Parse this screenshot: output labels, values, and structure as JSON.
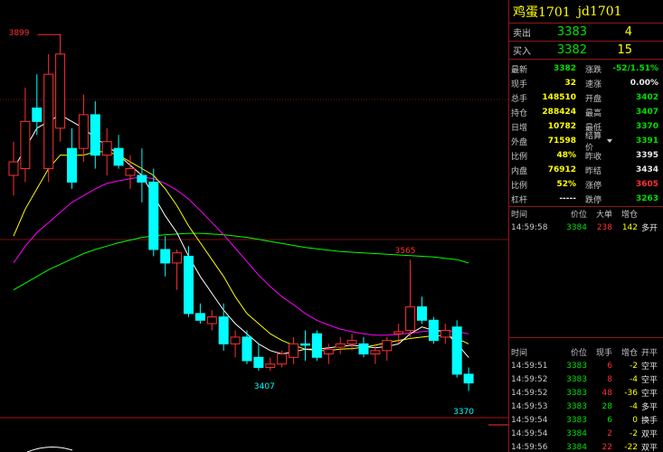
{
  "contract": {
    "name": "鸡蛋1701",
    "code": "jd1701"
  },
  "quote": {
    "ask_label": "卖出",
    "ask_price": "3383",
    "ask_vol": "4",
    "bid_label": "买入",
    "bid_price": "3382",
    "bid_vol": "15"
  },
  "stats": [
    {
      "l": "最新",
      "v": "3382",
      "vc": "green",
      "l2": "涨跌",
      "v2": "-52/1.51%",
      "v2c": "green"
    },
    {
      "l": "现手",
      "v": "32",
      "vc": "yellow",
      "l2": "速涨",
      "v2": "0.00%",
      "v2c": "white"
    },
    {
      "l": "总手",
      "v": "148510",
      "vc": "yellow",
      "l2": "开盘",
      "v2": "3402",
      "v2c": "green"
    },
    {
      "l": "持仓",
      "v": "288424",
      "vc": "yellow",
      "l2": "最高",
      "v2": "3407",
      "v2c": "green"
    },
    {
      "l": "日增",
      "v": "10782",
      "vc": "yellow",
      "l2": "最低",
      "v2": "3370",
      "v2c": "green"
    },
    {
      "l": "外盘",
      "v": "71598",
      "vc": "yellow",
      "l2": "结算价",
      "v2": "3391",
      "v2c": "green",
      "drop": true
    },
    {
      "l": "比例",
      "v": "48%",
      "vc": "yellow",
      "l2": "昨收",
      "v2": "3395",
      "v2c": "white"
    },
    {
      "l": "内盘",
      "v": "76912",
      "vc": "yellow",
      "l2": "昨结",
      "v2": "3434",
      "v2c": "white"
    },
    {
      "l": "比例",
      "v": "52%",
      "vc": "yellow",
      "l2": "涨停",
      "v2": "3605",
      "v2c": "red"
    },
    {
      "l": "杠杆",
      "v": "-----",
      "vc": "white",
      "l2": "跌停",
      "v2": "3263",
      "v2c": "green"
    }
  ],
  "big_trades": {
    "headers": [
      "时间",
      "价位",
      "大单",
      "增仓"
    ],
    "rows": [
      {
        "time": "14:59:58",
        "price": "3384",
        "big": "238",
        "pos": "142",
        "open": "多开"
      }
    ]
  },
  "trades": {
    "headers": [
      "时间",
      "价位",
      "现手",
      "增仓",
      "开平"
    ],
    "rows": [
      {
        "time": "14:59:51",
        "price": "3383",
        "vol": "6",
        "vc": "red",
        "pos": "-2",
        "open": "空平"
      },
      {
        "time": "14:59:52",
        "price": "3383",
        "vol": "8",
        "vc": "red",
        "pos": "-4",
        "open": "空平"
      },
      {
        "time": "14:59:52",
        "price": "3383",
        "vol": "48",
        "vc": "red",
        "pos": "-36",
        "open": "空平"
      },
      {
        "time": "14:59:53",
        "price": "3383",
        "vol": "28",
        "vc": "green",
        "pos": "-4",
        "open": "多平"
      },
      {
        "time": "14:59:54",
        "price": "3383",
        "vol": "6",
        "vc": "green",
        "pos": "0",
        "open": "换手"
      },
      {
        "time": "14:59:54",
        "price": "3384",
        "vol": "2",
        "vc": "red",
        "pos": "-2",
        "open": "双平"
      },
      {
        "time": "14:59:56",
        "price": "3384",
        "vol": "22",
        "vc": "red",
        "pos": "-22",
        "open": "双平"
      }
    ]
  },
  "colors": {
    "up": "#ff3030",
    "down": "#00ffff",
    "ma1": "#ffffff",
    "ma2": "#ffff00",
    "ma3": "#ff00ff",
    "ma4": "#00ff00"
  },
  "chart_data": {
    "type": "candlestick",
    "ylim": [
      3360,
      3910
    ],
    "candles": [
      {
        "o": 3690,
        "h": 3740,
        "l": 3660,
        "c": 3710
      },
      {
        "o": 3700,
        "h": 3820,
        "l": 3680,
        "c": 3770
      },
      {
        "o": 3790,
        "h": 3840,
        "l": 3750,
        "c": 3770
      },
      {
        "o": 3700,
        "h": 3870,
        "l": 3680,
        "c": 3840
      },
      {
        "o": 3760,
        "h": 3900,
        "l": 3740,
        "c": 3870
      },
      {
        "o": 3730,
        "h": 3760,
        "l": 3670,
        "c": 3680
      },
      {
        "o": 3730,
        "h": 3810,
        "l": 3710,
        "c": 3780
      },
      {
        "o": 3780,
        "h": 3800,
        "l": 3700,
        "c": 3720
      },
      {
        "o": 3720,
        "h": 3760,
        "l": 3690,
        "c": 3740
      },
      {
        "o": 3730,
        "h": 3750,
        "l": 3700,
        "c": 3705
      },
      {
        "o": 3690,
        "h": 3720,
        "l": 3670,
        "c": 3700
      },
      {
        "o": 3690,
        "h": 3730,
        "l": 3650,
        "c": 3680
      },
      {
        "o": 3680,
        "h": 3700,
        "l": 3570,
        "c": 3580
      },
      {
        "o": 3580,
        "h": 3600,
        "l": 3540,
        "c": 3560
      },
      {
        "o": 3560,
        "h": 3580,
        "l": 3520,
        "c": 3575
      },
      {
        "o": 3570,
        "h": 3585,
        "l": 3480,
        "c": 3485
      },
      {
        "o": 3485,
        "h": 3500,
        "l": 3470,
        "c": 3475
      },
      {
        "o": 3470,
        "h": 3490,
        "l": 3460,
        "c": 3480
      },
      {
        "o": 3480,
        "h": 3500,
        "l": 3430,
        "c": 3440
      },
      {
        "o": 3440,
        "h": 3460,
        "l": 3420,
        "c": 3450
      },
      {
        "o": 3450,
        "h": 3460,
        "l": 3410,
        "c": 3415
      },
      {
        "o": 3420,
        "h": 3440,
        "l": 3400,
        "c": 3405
      },
      {
        "o": 3405,
        "h": 3420,
        "l": 3400,
        "c": 3410
      },
      {
        "o": 3410,
        "h": 3430,
        "l": 3405,
        "c": 3425
      },
      {
        "o": 3420,
        "h": 3450,
        "l": 3410,
        "c": 3440
      },
      {
        "o": 3440,
        "h": 3460,
        "l": 3415,
        "c": 3438
      },
      {
        "o": 3455,
        "h": 3460,
        "l": 3415,
        "c": 3420
      },
      {
        "o": 3425,
        "h": 3440,
        "l": 3410,
        "c": 3432
      },
      {
        "o": 3435,
        "h": 3450,
        "l": 3425,
        "c": 3440
      },
      {
        "o": 3440,
        "h": 3455,
        "l": 3430,
        "c": 3445
      },
      {
        "o": 3440,
        "h": 3450,
        "l": 3420,
        "c": 3425
      },
      {
        "o": 3425,
        "h": 3440,
        "l": 3410,
        "c": 3430
      },
      {
        "o": 3430,
        "h": 3450,
        "l": 3415,
        "c": 3445
      },
      {
        "o": 3455,
        "h": 3470,
        "l": 3440,
        "c": 3458
      },
      {
        "o": 3460,
        "h": 3565,
        "l": 3450,
        "c": 3495
      },
      {
        "o": 3495,
        "h": 3510,
        "l": 3470,
        "c": 3475
      },
      {
        "o": 3475,
        "h": 3480,
        "l": 3440,
        "c": 3445
      },
      {
        "o": 3450,
        "h": 3470,
        "l": 3440,
        "c": 3460
      },
      {
        "o": 3465,
        "h": 3475,
        "l": 3390,
        "c": 3395
      },
      {
        "o": 3395,
        "h": 3405,
        "l": 3370,
        "c": 3382
      }
    ],
    "ma1": [
      3700,
      3730,
      3760,
      3770,
      3780,
      3770,
      3760,
      3745,
      3735,
      3720,
      3705,
      3690,
      3660,
      3630,
      3605,
      3570,
      3540,
      3515,
      3490,
      3470,
      3455,
      3440,
      3430,
      3425,
      3428,
      3432,
      3432,
      3434,
      3436,
      3438,
      3436,
      3434,
      3436,
      3440,
      3455,
      3465,
      3460,
      3458,
      3440,
      3420
    ],
    "ma2": [
      3600,
      3640,
      3670,
      3700,
      3720,
      3720,
      3720,
      3725,
      3725,
      3720,
      3710,
      3700,
      3690,
      3670,
      3645,
      3615,
      3590,
      3565,
      3540,
      3510,
      3485,
      3470,
      3455,
      3445,
      3438,
      3432,
      3430,
      3430,
      3432,
      3433,
      3435,
      3438,
      3442,
      3445,
      3448,
      3450,
      3452,
      3452,
      3448,
      3440
    ],
    "ma3": [
      3560,
      3585,
      3605,
      3620,
      3635,
      3650,
      3660,
      3670,
      3678,
      3682,
      3685,
      3688,
      3685,
      3678,
      3668,
      3655,
      3638,
      3620,
      3602,
      3582,
      3562,
      3542,
      3525,
      3510,
      3498,
      3485,
      3475,
      3468,
      3462,
      3458,
      3455,
      3453,
      3453,
      3454,
      3456,
      3458,
      3460,
      3460,
      3458,
      3455
    ],
    "ma4": [
      3520,
      3530,
      3540,
      3550,
      3558,
      3566,
      3574,
      3580,
      3585,
      3590,
      3594,
      3598,
      3600,
      3602,
      3603,
      3604,
      3604,
      3603,
      3602,
      3600,
      3598,
      3595,
      3592,
      3589,
      3586,
      3583,
      3581,
      3579,
      3577,
      3576,
      3575,
      3574,
      3573,
      3572,
      3571,
      3570,
      3569,
      3567,
      3565,
      3560
    ],
    "annotations": {
      "high_label": "3899",
      "high_index": 4,
      "high_value": 3899,
      "peak_label": "3565",
      "peak_index": 34,
      "peak_value": 3565,
      "low1_label": "3407",
      "low1_index": 21,
      "low1_value": 3407,
      "low2_label": "3370",
      "low2_index": 39,
      "low2_value": 3370
    }
  }
}
